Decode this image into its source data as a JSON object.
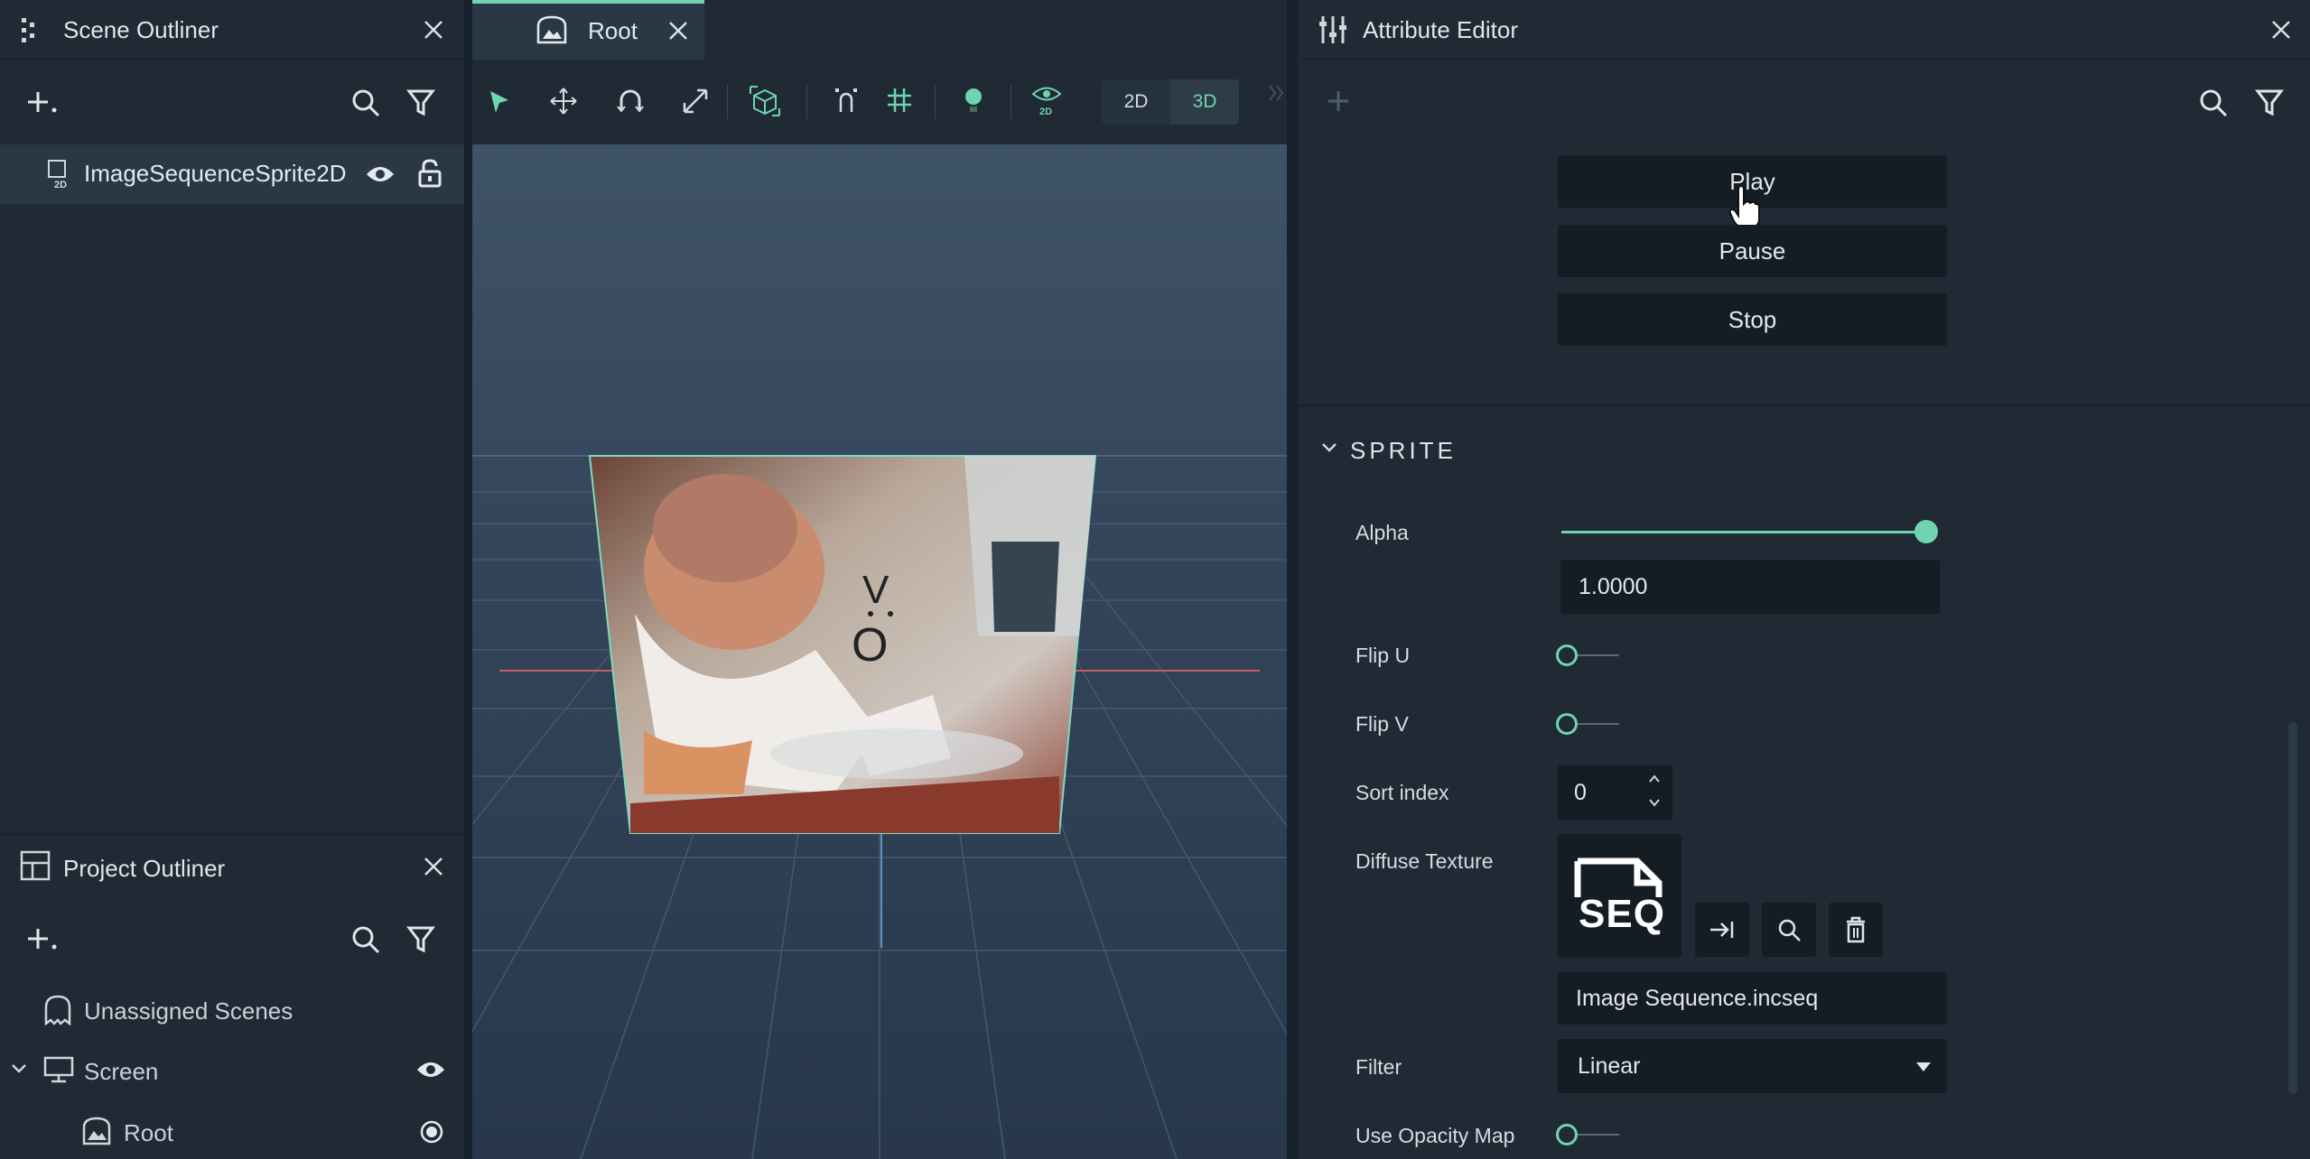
{
  "scene_outliner": {
    "title": "Scene Outliner",
    "item": "ImageSequenceSprite2D"
  },
  "project_outliner": {
    "title": "Project Outliner",
    "unassigned": "Unassigned Scenes",
    "screen": "Screen",
    "root": "Root"
  },
  "viewport": {
    "tab_label": "Root",
    "btn_2d": "2D",
    "btn_3d": "3D",
    "overlay_text": "V",
    "overlay_text2": "O"
  },
  "attribute_editor": {
    "title": "Attribute Editor",
    "play": "Play",
    "pause": "Pause",
    "stop": "Stop",
    "section": "SPRITE",
    "alpha_label": "Alpha",
    "alpha_value": "1.0000",
    "alpha_level": 1.0,
    "flip_u": "Flip U",
    "flip_v": "Flip V",
    "sort_index_label": "Sort index",
    "sort_index_value": "0",
    "diffuse_label": "Diffuse Texture",
    "thumb_text": "SEQ",
    "texture_file": "Image Sequence.incseq",
    "filter_label": "Filter",
    "filter_value": "Linear",
    "opacity_label": "Use Opacity Map"
  },
  "colors": {
    "accent": "#6fd4b0",
    "panel": "#1f2a35",
    "viewport_top": "#3f5366"
  }
}
